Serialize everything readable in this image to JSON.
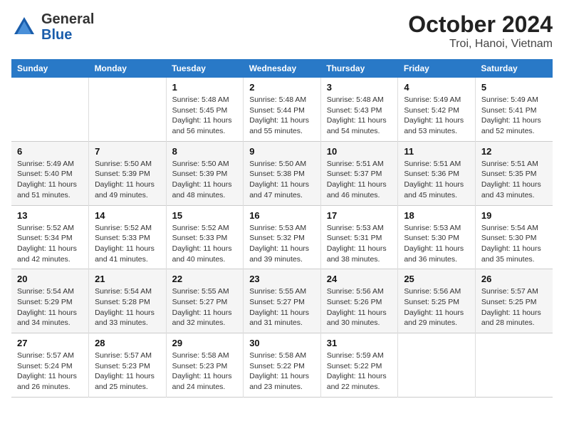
{
  "logo": {
    "general": "General",
    "blue": "Blue"
  },
  "title": "October 2024",
  "subtitle": "Troi, Hanoi, Vietnam",
  "weekdays": [
    "Sunday",
    "Monday",
    "Tuesday",
    "Wednesday",
    "Thursday",
    "Friday",
    "Saturday"
  ],
  "weeks": [
    [
      {
        "day": "",
        "info": ""
      },
      {
        "day": "",
        "info": ""
      },
      {
        "day": "1",
        "info": "Sunrise: 5:48 AM\nSunset: 5:45 PM\nDaylight: 11 hours and 56 minutes."
      },
      {
        "day": "2",
        "info": "Sunrise: 5:48 AM\nSunset: 5:44 PM\nDaylight: 11 hours and 55 minutes."
      },
      {
        "day": "3",
        "info": "Sunrise: 5:48 AM\nSunset: 5:43 PM\nDaylight: 11 hours and 54 minutes."
      },
      {
        "day": "4",
        "info": "Sunrise: 5:49 AM\nSunset: 5:42 PM\nDaylight: 11 hours and 53 minutes."
      },
      {
        "day": "5",
        "info": "Sunrise: 5:49 AM\nSunset: 5:41 PM\nDaylight: 11 hours and 52 minutes."
      }
    ],
    [
      {
        "day": "6",
        "info": "Sunrise: 5:49 AM\nSunset: 5:40 PM\nDaylight: 11 hours and 51 minutes."
      },
      {
        "day": "7",
        "info": "Sunrise: 5:50 AM\nSunset: 5:39 PM\nDaylight: 11 hours and 49 minutes."
      },
      {
        "day": "8",
        "info": "Sunrise: 5:50 AM\nSunset: 5:39 PM\nDaylight: 11 hours and 48 minutes."
      },
      {
        "day": "9",
        "info": "Sunrise: 5:50 AM\nSunset: 5:38 PM\nDaylight: 11 hours and 47 minutes."
      },
      {
        "day": "10",
        "info": "Sunrise: 5:51 AM\nSunset: 5:37 PM\nDaylight: 11 hours and 46 minutes."
      },
      {
        "day": "11",
        "info": "Sunrise: 5:51 AM\nSunset: 5:36 PM\nDaylight: 11 hours and 45 minutes."
      },
      {
        "day": "12",
        "info": "Sunrise: 5:51 AM\nSunset: 5:35 PM\nDaylight: 11 hours and 43 minutes."
      }
    ],
    [
      {
        "day": "13",
        "info": "Sunrise: 5:52 AM\nSunset: 5:34 PM\nDaylight: 11 hours and 42 minutes."
      },
      {
        "day": "14",
        "info": "Sunrise: 5:52 AM\nSunset: 5:33 PM\nDaylight: 11 hours and 41 minutes."
      },
      {
        "day": "15",
        "info": "Sunrise: 5:52 AM\nSunset: 5:33 PM\nDaylight: 11 hours and 40 minutes."
      },
      {
        "day": "16",
        "info": "Sunrise: 5:53 AM\nSunset: 5:32 PM\nDaylight: 11 hours and 39 minutes."
      },
      {
        "day": "17",
        "info": "Sunrise: 5:53 AM\nSunset: 5:31 PM\nDaylight: 11 hours and 38 minutes."
      },
      {
        "day": "18",
        "info": "Sunrise: 5:53 AM\nSunset: 5:30 PM\nDaylight: 11 hours and 36 minutes."
      },
      {
        "day": "19",
        "info": "Sunrise: 5:54 AM\nSunset: 5:30 PM\nDaylight: 11 hours and 35 minutes."
      }
    ],
    [
      {
        "day": "20",
        "info": "Sunrise: 5:54 AM\nSunset: 5:29 PM\nDaylight: 11 hours and 34 minutes."
      },
      {
        "day": "21",
        "info": "Sunrise: 5:54 AM\nSunset: 5:28 PM\nDaylight: 11 hours and 33 minutes."
      },
      {
        "day": "22",
        "info": "Sunrise: 5:55 AM\nSunset: 5:27 PM\nDaylight: 11 hours and 32 minutes."
      },
      {
        "day": "23",
        "info": "Sunrise: 5:55 AM\nSunset: 5:27 PM\nDaylight: 11 hours and 31 minutes."
      },
      {
        "day": "24",
        "info": "Sunrise: 5:56 AM\nSunset: 5:26 PM\nDaylight: 11 hours and 30 minutes."
      },
      {
        "day": "25",
        "info": "Sunrise: 5:56 AM\nSunset: 5:25 PM\nDaylight: 11 hours and 29 minutes."
      },
      {
        "day": "26",
        "info": "Sunrise: 5:57 AM\nSunset: 5:25 PM\nDaylight: 11 hours and 28 minutes."
      }
    ],
    [
      {
        "day": "27",
        "info": "Sunrise: 5:57 AM\nSunset: 5:24 PM\nDaylight: 11 hours and 26 minutes."
      },
      {
        "day": "28",
        "info": "Sunrise: 5:57 AM\nSunset: 5:23 PM\nDaylight: 11 hours and 25 minutes."
      },
      {
        "day": "29",
        "info": "Sunrise: 5:58 AM\nSunset: 5:23 PM\nDaylight: 11 hours and 24 minutes."
      },
      {
        "day": "30",
        "info": "Sunrise: 5:58 AM\nSunset: 5:22 PM\nDaylight: 11 hours and 23 minutes."
      },
      {
        "day": "31",
        "info": "Sunrise: 5:59 AM\nSunset: 5:22 PM\nDaylight: 11 hours and 22 minutes."
      },
      {
        "day": "",
        "info": ""
      },
      {
        "day": "",
        "info": ""
      }
    ]
  ]
}
